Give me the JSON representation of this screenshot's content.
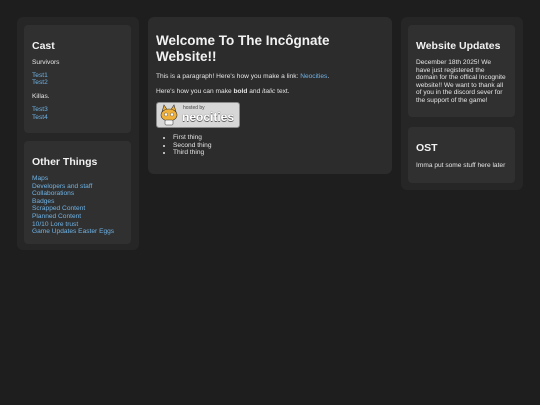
{
  "left": {
    "cast": {
      "title": "Cast",
      "survivors_label": "Survivors",
      "survivor_links": [
        "Test1",
        "Test2"
      ],
      "killers_label": "Killas.",
      "killer_links": [
        "Test3",
        "Test4"
      ]
    },
    "other": {
      "title": "Other Things",
      "links": [
        "Maps",
        "Developers and staff",
        "Collaborations",
        "Badges",
        "Scrapped Content",
        "Planned Content",
        "10/10 Lore trust",
        "Game Updates Easter Eggs"
      ]
    }
  },
  "main": {
    "title": "Welcome To The Incôgnate Website!!",
    "para1_prefix": "This is a paragraph! Here's how you make a link: ",
    "para1_link": "Neocities",
    "para1_suffix": ".",
    "para2_prefix": "Here's how you can make ",
    "para2_bold": "bold",
    "para2_middle": " and ",
    "para2_italic": "italic",
    "para2_suffix": " text.",
    "badge_small": "hosted by",
    "badge_big": "neocities",
    "list": [
      "First thing",
      "Second thing",
      "Third thing"
    ]
  },
  "right": {
    "updates": {
      "title": "Website Updates",
      "text": "December 18th 2025! We have just registered the domain for the offical Incognite website!! We want to thank all of you in the discord sever for the support of the game!"
    },
    "ost": {
      "title": "OST",
      "text": "Imma put some stuff here later"
    }
  }
}
